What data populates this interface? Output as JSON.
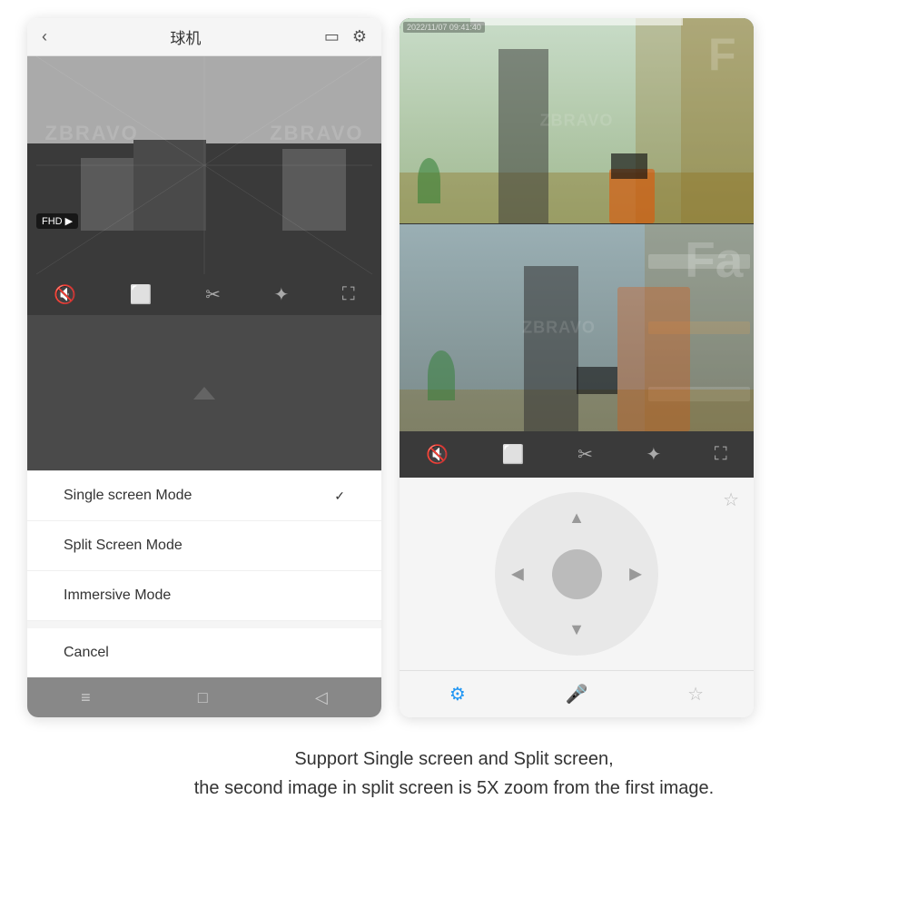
{
  "left_phone": {
    "header": {
      "back_label": "‹",
      "title": "球机",
      "display_icon": "▭",
      "settings_icon": "⚙"
    },
    "camera": {
      "fhd_label": "FHD",
      "fhd_arrow": "▶",
      "watermark1": "ZBRAVO",
      "watermark2": "ZBRAVO"
    },
    "controls": {
      "mute_icon": "🔇",
      "record_icon": "⬜",
      "scissors_icon": "✂",
      "brightness_icon": "✦",
      "fullscreen_icon": "⛶"
    },
    "menu": {
      "single_screen_label": "Single screen Mode",
      "single_screen_check": "✓",
      "split_screen_label": "Split Screen Mode",
      "immersive_label": "Immersive Mode",
      "cancel_label": "Cancel"
    },
    "nav": {
      "menu_icon": "≡",
      "home_icon": "□",
      "back_icon": "◁"
    }
  },
  "right_phone": {
    "timestamp": "2022/11/07 09:41:40",
    "watermark": "ZBRAVO",
    "controls": {
      "mute_icon": "🔇",
      "record_icon": "⬜",
      "scissors_icon": "✂",
      "brightness_icon": "✦",
      "fullscreen_icon": "⛶"
    },
    "ptz": {
      "up_arrow": "▲",
      "down_arrow": "▼",
      "left_arrow": "◀",
      "right_arrow": "▶",
      "star_icon": "☆"
    },
    "toolbar": {
      "settings_icon": "⚙",
      "mic_icon": "🎤",
      "favorite_icon": "☆"
    }
  },
  "bottom_text": {
    "line1": "Support Single screen and Split screen,",
    "line2": "the second image in split screen is 5X zoom from the first image."
  }
}
